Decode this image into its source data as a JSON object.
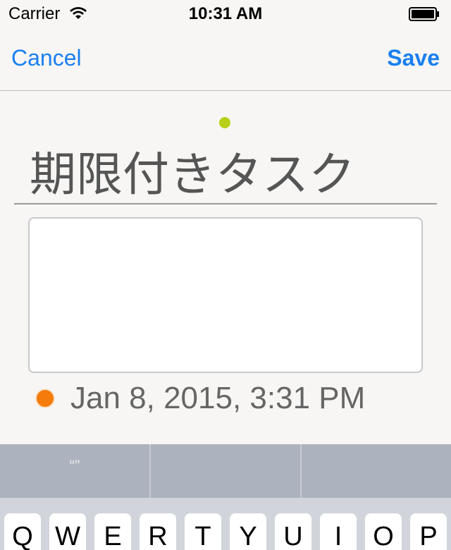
{
  "status_bar": {
    "carrier": "Carrier",
    "time": "10:31 AM",
    "wifi_icon": "wifi-icon",
    "battery_icon": "battery-icon"
  },
  "nav": {
    "cancel_label": "Cancel",
    "save_label": "Save"
  },
  "task": {
    "title": "期限付きタスク",
    "notes": "",
    "due_date": "Jan 8, 2015, 3:31 PM"
  },
  "colors": {
    "accent_dot": "#b8cf1a",
    "due_dot": "#f57b0a",
    "link": "#1a7ff0"
  },
  "keyboard": {
    "suggestions": [
      "“”",
      "",
      ""
    ],
    "top_row": [
      "Q",
      "W",
      "E",
      "R",
      "T",
      "Y",
      "U",
      "I",
      "O",
      "P"
    ]
  }
}
